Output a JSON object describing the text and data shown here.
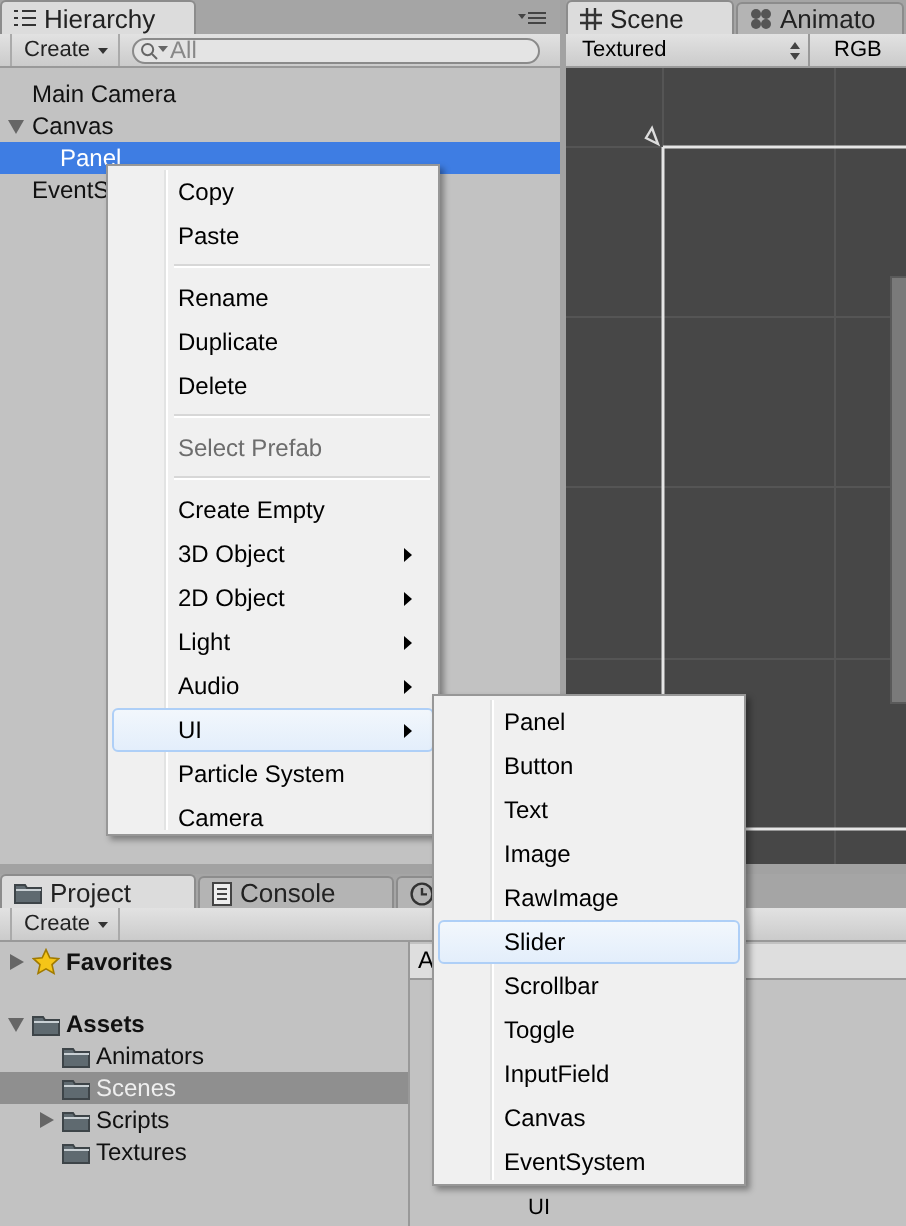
{
  "hierarchy": {
    "tab": "Hierarchy",
    "create_button": "Create",
    "search": {
      "placeholder": "All"
    },
    "tree": [
      {
        "label": "Main Camera",
        "selected": false
      },
      {
        "label": "Canvas",
        "selected": false,
        "expanded": true,
        "children": [
          {
            "label": "Panel",
            "selected": true
          }
        ]
      },
      {
        "label": "EventS",
        "selected": false
      }
    ]
  },
  "scene": {
    "tabs": [
      {
        "label": "Scene",
        "kind": "grid",
        "selected": true
      },
      {
        "label": "Animato",
        "kind": "nodes",
        "selected": false
      }
    ],
    "shading": "Textured",
    "channel": "RGB"
  },
  "project": {
    "tabs": [
      {
        "label": "Project",
        "kind": "folder",
        "selected": true
      },
      {
        "label": "Console",
        "kind": "console",
        "selected": false
      },
      {
        "kind": "clock",
        "selected": false
      }
    ],
    "create_button": "Create",
    "tree": [
      {
        "label": "Favorites",
        "kind": "favorites",
        "selected": false,
        "expanded": false
      },
      {
        "label": "Assets",
        "kind": "folder",
        "selected": false,
        "expanded": true,
        "children": [
          {
            "label": "Animators",
            "kind": "folder",
            "selected": false
          },
          {
            "label": "Scenes",
            "kind": "folder",
            "selected": true
          },
          {
            "label": "Scripts",
            "kind": "folder",
            "selected": false,
            "expanded": false
          },
          {
            "label": "Textures",
            "kind": "folder",
            "selected": false
          }
        ]
      }
    ],
    "column_header": "A",
    "items": [
      "UI"
    ]
  },
  "context_menu": {
    "items": [
      {
        "kind": "item",
        "label": "Copy",
        "disabled": false,
        "submenu": false,
        "selected": false
      },
      {
        "kind": "item",
        "label": "Paste",
        "disabled": false,
        "submenu": false,
        "selected": false
      },
      {
        "kind": "separator"
      },
      {
        "kind": "item",
        "label": "Rename",
        "disabled": false,
        "submenu": false,
        "selected": false
      },
      {
        "kind": "item",
        "label": "Duplicate",
        "disabled": false,
        "submenu": false,
        "selected": false
      },
      {
        "kind": "item",
        "label": "Delete",
        "disabled": false,
        "submenu": false,
        "selected": false
      },
      {
        "kind": "separator"
      },
      {
        "kind": "item",
        "label": "Select Prefab",
        "disabled": true,
        "submenu": false,
        "selected": false
      },
      {
        "kind": "separator"
      },
      {
        "kind": "item",
        "label": "Create Empty",
        "disabled": false,
        "submenu": false,
        "selected": false
      },
      {
        "kind": "item",
        "label": "3D Object",
        "disabled": false,
        "submenu": true,
        "selected": false
      },
      {
        "kind": "item",
        "label": "2D Object",
        "disabled": false,
        "submenu": true,
        "selected": false
      },
      {
        "kind": "item",
        "label": "Light",
        "disabled": false,
        "submenu": true,
        "selected": false
      },
      {
        "kind": "item",
        "label": "Audio",
        "disabled": false,
        "submenu": true,
        "selected": false
      },
      {
        "kind": "item",
        "label": "UI",
        "disabled": false,
        "submenu": true,
        "selected": true
      },
      {
        "kind": "item",
        "label": "Particle System",
        "disabled": false,
        "submenu": false,
        "selected": false
      },
      {
        "kind": "item",
        "label": "Camera",
        "disabled": false,
        "submenu": false,
        "selected": false
      }
    ]
  },
  "submenu": {
    "items": [
      {
        "label": "Panel",
        "selected": false
      },
      {
        "label": "Button",
        "selected": false
      },
      {
        "label": "Text",
        "selected": false
      },
      {
        "label": "Image",
        "selected": false
      },
      {
        "label": "RawImage",
        "selected": false
      },
      {
        "label": "Slider",
        "selected": true
      },
      {
        "label": "Scrollbar",
        "selected": false
      },
      {
        "label": "Toggle",
        "selected": false
      },
      {
        "label": "InputField",
        "selected": false
      },
      {
        "label": "Canvas",
        "selected": false
      },
      {
        "label": "EventSystem",
        "selected": false
      }
    ]
  }
}
